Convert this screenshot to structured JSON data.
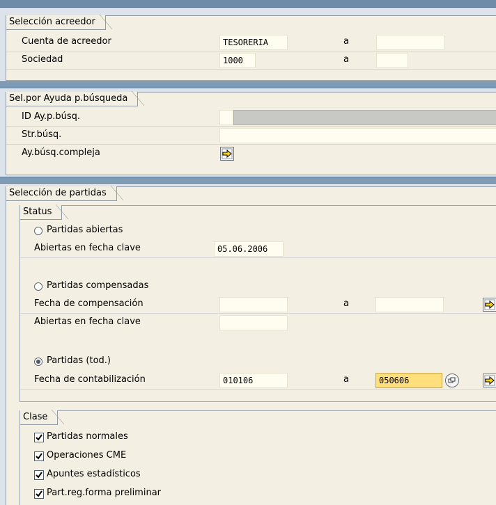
{
  "sections": {
    "acreedor": {
      "title": "Selección acreedor",
      "rows": [
        {
          "label": "Cuenta de acreedor",
          "from": "TESORERIA",
          "to_label": "a",
          "to": ""
        },
        {
          "label": "Sociedad",
          "from": "1000",
          "to_label": "a",
          "to": ""
        }
      ]
    },
    "ayuda": {
      "title": "Sel.por Ayuda p.búsqueda",
      "rows": [
        {
          "label": "ID Ay.p.búsq."
        },
        {
          "label": "Str.búsq."
        },
        {
          "label": "Ay.búsq.compleja"
        }
      ]
    },
    "partidas": {
      "title": "Selección de partidas",
      "status": {
        "title": "Status",
        "abiertas": {
          "label": "Partidas abiertas",
          "selected": false,
          "fecha_label": "Abiertas en fecha clave",
          "fecha": "05.06.2006"
        },
        "compensadas": {
          "label": "Partidas compensadas",
          "selected": false,
          "fecha_comp_label": "Fecha de compensación",
          "to_label": "a",
          "fecha_clave_label": "Abiertas en fecha clave"
        },
        "todas": {
          "label": "Partidas (tod.)",
          "selected": true,
          "fecha_cont_label": "Fecha de contabilización",
          "from": "010106",
          "to_label": "a",
          "to": "050606"
        }
      },
      "clase": {
        "title": "Clase",
        "items": [
          {
            "label": "Partidas normales",
            "checked": true
          },
          {
            "label": "Operaciones CME",
            "checked": true
          },
          {
            "label": "Apuntes estadísticos",
            "checked": true
          },
          {
            "label": "Part.reg.forma preliminar",
            "checked": true
          }
        ]
      }
    }
  },
  "icons": {
    "execute": "arrow-right-icon",
    "multiple-selection": "multiple-selection-icon",
    "search-help": "search-help-icon"
  }
}
